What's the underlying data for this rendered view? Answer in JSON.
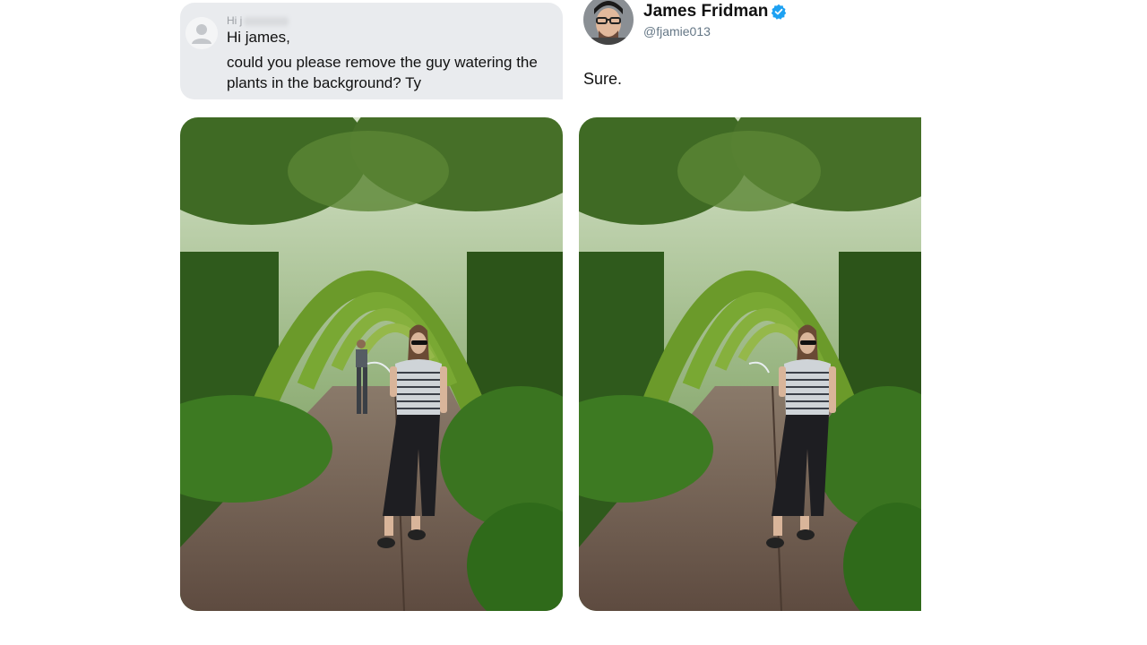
{
  "request": {
    "sender_prefix": "Hi j",
    "greeting": "Hi james,",
    "message": "could you please remove the guy watering the plants in the background? Ty"
  },
  "reply": {
    "name": "James Fridman",
    "handle": "@fjamie013",
    "message": "Sure."
  },
  "icons": {
    "request_avatar": "default-user-avatar",
    "verified": "verified-badge-icon"
  },
  "colors": {
    "bubble_bg": "#e9ebee",
    "verified_blue": "#1da1f2",
    "handle_gray": "#657786"
  }
}
